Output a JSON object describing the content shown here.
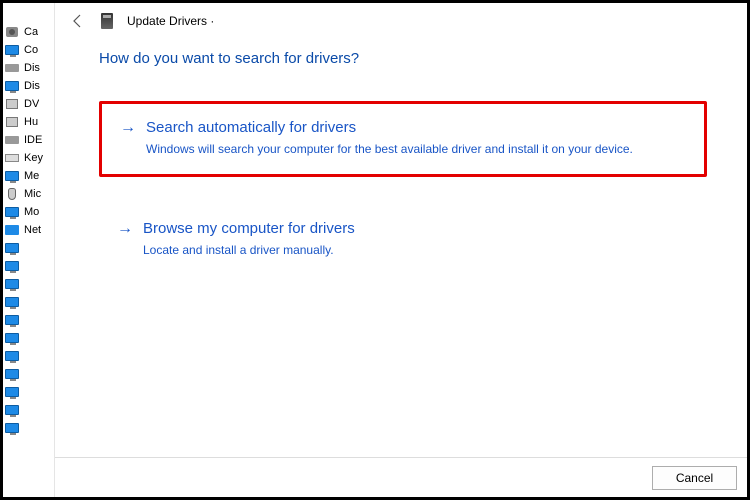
{
  "devicePane": {
    "items": [
      {
        "icon": "camera",
        "label": "Ca"
      },
      {
        "icon": "monitor",
        "label": "Co"
      },
      {
        "icon": "hdd",
        "label": "Dis"
      },
      {
        "icon": "monitor",
        "label": "Dis"
      },
      {
        "icon": "usb",
        "label": "DV"
      },
      {
        "icon": "usb",
        "label": "Hu"
      },
      {
        "icon": "hdd",
        "label": "IDE"
      },
      {
        "icon": "keyboard",
        "label": "Key"
      },
      {
        "icon": "monitor",
        "label": "Me"
      },
      {
        "icon": "mouse",
        "label": "Mic"
      },
      {
        "icon": "monitor",
        "label": "Mo"
      },
      {
        "icon": "net",
        "label": "Net"
      },
      {
        "icon": "monitor",
        "label": ""
      },
      {
        "icon": "monitor",
        "label": ""
      },
      {
        "icon": "monitor",
        "label": ""
      },
      {
        "icon": "monitor",
        "label": ""
      },
      {
        "icon": "monitor",
        "label": ""
      },
      {
        "icon": "monitor",
        "label": ""
      },
      {
        "icon": "monitor",
        "label": ""
      },
      {
        "icon": "monitor",
        "label": ""
      },
      {
        "icon": "monitor",
        "label": ""
      },
      {
        "icon": "monitor",
        "label": ""
      },
      {
        "icon": "monitor",
        "label": ""
      }
    ]
  },
  "dialog": {
    "title": "Update Drivers ·",
    "heading": "How do you want to search for drivers?",
    "options": [
      {
        "title": "Search automatically for drivers",
        "desc": "Windows will search your computer for the best available driver and install it on your device.",
        "highlight": true
      },
      {
        "title": "Browse my computer for drivers",
        "desc": "Locate and install a driver manually.",
        "highlight": false
      }
    ],
    "cancel": "Cancel"
  }
}
